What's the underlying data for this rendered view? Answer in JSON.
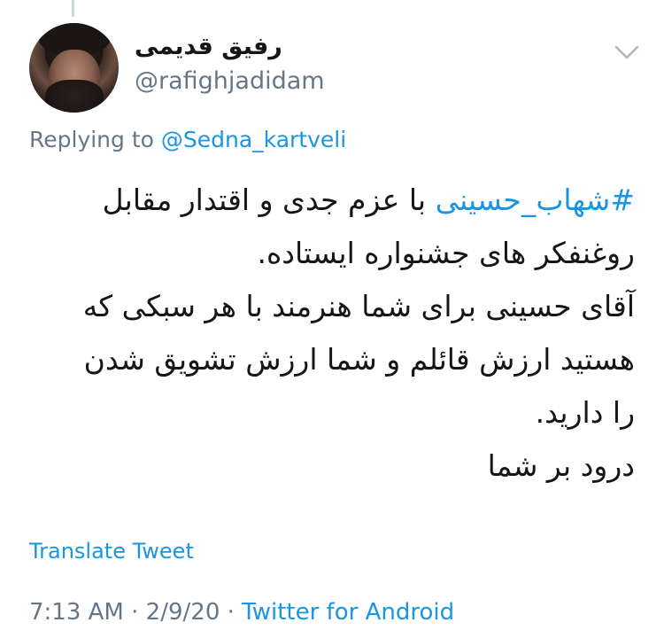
{
  "tweet": {
    "author": {
      "display_name": "رفیق قدیمی",
      "handle": "@rafighjadidam"
    },
    "reply": {
      "prefix": "Replying to ",
      "mention": "@Sedna_kartveli"
    },
    "body": {
      "hashtag": "#شهاب_حسینی",
      "line1_rest": " با عزم جدی و اقتدار مقابل",
      "line2": "روغنفکر های جشنواره ایستاده.",
      "line3": "آقای حسینی برای شما هنرمند با هر سبکی که",
      "line4": "هستید ارزش قائلم و شما ارزش تشویق شدن",
      "line5": "را دارید.",
      "line6": "درود بر شما"
    },
    "translate_label": "Translate Tweet",
    "meta": {
      "time": "7:13 AM",
      "separator1": " · ",
      "date": "2/9/20",
      "separator2": " · ",
      "source": "Twitter for Android"
    }
  },
  "icons": {
    "menu": "chevron-down-icon"
  },
  "colors": {
    "link": "#1b95e0",
    "secondary_text": "#657786",
    "primary_text": "#14171a",
    "thread_line": "#ccd6dd"
  }
}
